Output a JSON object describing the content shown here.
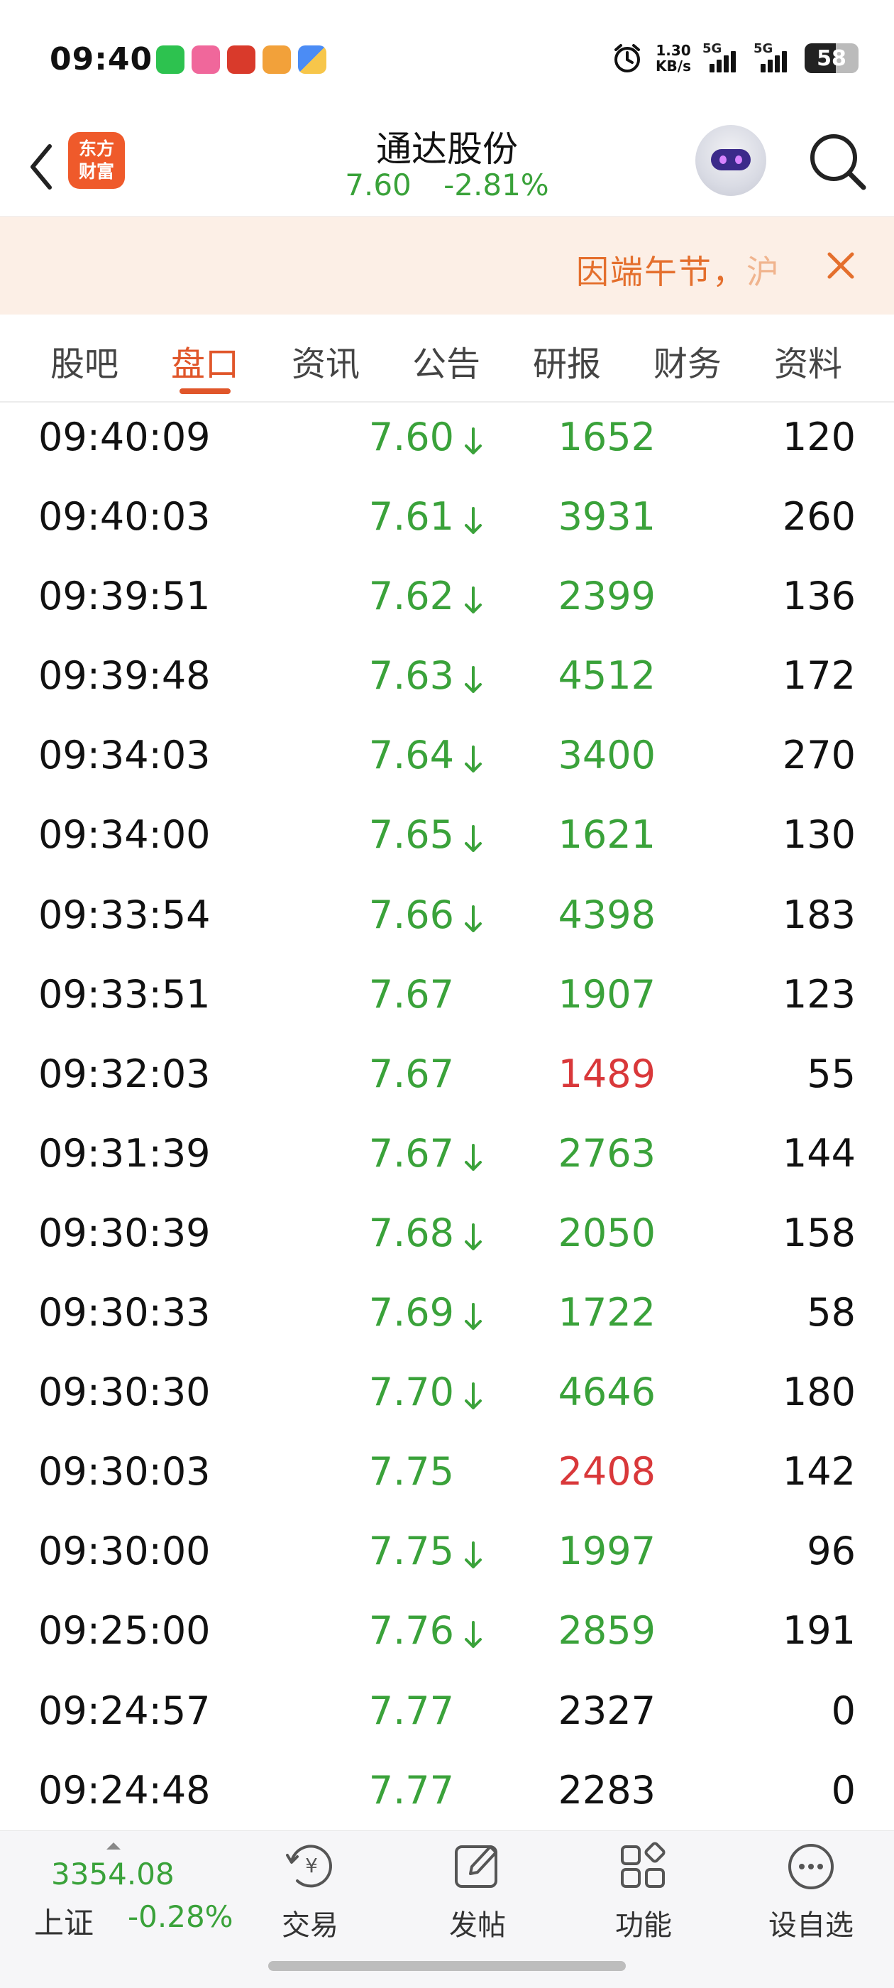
{
  "status_bar": {
    "time": "09:40",
    "net_speed_value": "1.30",
    "net_speed_unit": "KB/s",
    "signal1_label": "5G",
    "signal2_label": "5G",
    "battery": "58"
  },
  "header": {
    "logo_line1": "东方",
    "logo_line2": "财富",
    "stock_name": "通达股份",
    "price": "7.60",
    "change_pct": "-2.81%"
  },
  "banner": {
    "text": "因端午节，",
    "text_faded": "沪"
  },
  "tabs": [
    {
      "label": "股吧",
      "active": false
    },
    {
      "label": "盘口",
      "active": true
    },
    {
      "label": "资讯",
      "active": false
    },
    {
      "label": "公告",
      "active": false
    },
    {
      "label": "研报",
      "active": false
    },
    {
      "label": "财务",
      "active": false
    },
    {
      "label": "资料",
      "active": false
    }
  ],
  "ticks": [
    {
      "time": "09:40:09",
      "price": "7.60",
      "down": true,
      "volume": "1652",
      "vcolor": "green",
      "count": "120"
    },
    {
      "time": "09:40:03",
      "price": "7.61",
      "down": true,
      "volume": "3931",
      "vcolor": "green",
      "count": "260"
    },
    {
      "time": "09:39:51",
      "price": "7.62",
      "down": true,
      "volume": "2399",
      "vcolor": "green",
      "count": "136"
    },
    {
      "time": "09:39:48",
      "price": "7.63",
      "down": true,
      "volume": "4512",
      "vcolor": "green",
      "count": "172"
    },
    {
      "time": "09:34:03",
      "price": "7.64",
      "down": true,
      "volume": "3400",
      "vcolor": "green",
      "count": "270"
    },
    {
      "time": "09:34:00",
      "price": "7.65",
      "down": true,
      "volume": "1621",
      "vcolor": "green",
      "count": "130"
    },
    {
      "time": "09:33:54",
      "price": "7.66",
      "down": true,
      "volume": "4398",
      "vcolor": "green",
      "count": "183"
    },
    {
      "time": "09:33:51",
      "price": "7.67",
      "down": false,
      "volume": "1907",
      "vcolor": "green",
      "count": "123"
    },
    {
      "time": "09:32:03",
      "price": "7.67",
      "down": false,
      "volume": "1489",
      "vcolor": "red",
      "count": "55"
    },
    {
      "time": "09:31:39",
      "price": "7.67",
      "down": true,
      "volume": "2763",
      "vcolor": "green",
      "count": "144"
    },
    {
      "time": "09:30:39",
      "price": "7.68",
      "down": true,
      "volume": "2050",
      "vcolor": "green",
      "count": "158"
    },
    {
      "time": "09:30:33",
      "price": "7.69",
      "down": true,
      "volume": "1722",
      "vcolor": "green",
      "count": "58"
    },
    {
      "time": "09:30:30",
      "price": "7.70",
      "down": true,
      "volume": "4646",
      "vcolor": "green",
      "count": "180"
    },
    {
      "time": "09:30:03",
      "price": "7.75",
      "down": false,
      "volume": "2408",
      "vcolor": "red",
      "count": "142"
    },
    {
      "time": "09:30:00",
      "price": "7.75",
      "down": true,
      "volume": "1997",
      "vcolor": "green",
      "count": "96"
    },
    {
      "time": "09:25:00",
      "price": "7.76",
      "down": true,
      "volume": "2859",
      "vcolor": "green",
      "count": "191"
    },
    {
      "time": "09:24:57",
      "price": "7.77",
      "down": false,
      "volume": "2327",
      "vcolor": "black",
      "count": "0"
    },
    {
      "time": "09:24:48",
      "price": "7.77",
      "down": false,
      "volume": "2283",
      "vcolor": "black",
      "count": "0"
    }
  ],
  "bottom_bar": {
    "index_value": "3354.08",
    "index_name": "上证",
    "index_change": "-0.28%",
    "nav": [
      {
        "label": "交易",
        "icon": "trade-icon"
      },
      {
        "label": "发帖",
        "icon": "post-icon"
      },
      {
        "label": "功能",
        "icon": "functions-icon"
      },
      {
        "label": "设自选",
        "icon": "add-watchlist-icon"
      }
    ]
  },
  "colors": {
    "green": "#3aa23a",
    "red": "#d9383a",
    "black": "#111111",
    "accent": "#e0562a",
    "banner_bg": "#fcefe6"
  }
}
